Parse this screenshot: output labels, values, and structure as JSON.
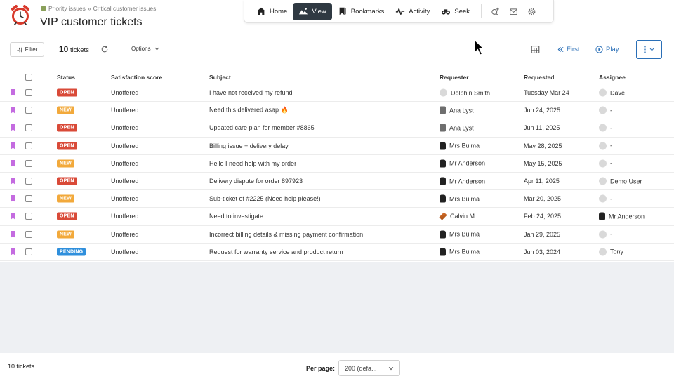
{
  "header": {
    "breadcrumb": {
      "parent": "Priority issues",
      "separator": "»",
      "current": "Critical customer issues"
    },
    "title": "VIP customer tickets"
  },
  "nav": {
    "items": [
      {
        "label": "Home",
        "icon": "home-icon",
        "active": false
      },
      {
        "label": "View",
        "icon": "view-icon",
        "active": true
      },
      {
        "label": "Bookmarks",
        "icon": "bookmarks-icon",
        "active": false
      },
      {
        "label": "Activity",
        "icon": "activity-icon",
        "active": false
      },
      {
        "label": "Seek",
        "icon": "binoculars-icon",
        "active": false
      }
    ],
    "icons": [
      "search-add-icon",
      "inbox-icon",
      "gear-icon"
    ]
  },
  "toolbar": {
    "filter_label": "Filter",
    "count_number": "10",
    "count_label": "tickets",
    "options_label": "Options",
    "first_label": "First",
    "play_label": "Play"
  },
  "table": {
    "columns": [
      "Status",
      "Satisfaction score",
      "Subject",
      "Requester",
      "Requested",
      "Assignee"
    ],
    "rows": [
      {
        "status": "OPEN",
        "satisfaction": "Unoffered",
        "subject": "I have not received my refund",
        "requester": "Dolphin Smith",
        "req_avatar": "gray",
        "requested": "Tuesday Mar 24",
        "assignee": "Dave",
        "asg_avatar": "gray"
      },
      {
        "status": "NEW",
        "satisfaction": "Unoffered",
        "subject": "Need this delivered asap 🔥",
        "requester": "Ana Lyst",
        "req_avatar": "lamp",
        "requested": "Jun 24, 2025",
        "assignee": "-",
        "asg_avatar": "gray"
      },
      {
        "status": "OPEN",
        "satisfaction": "Unoffered",
        "subject": "Updated care plan for member #8865",
        "requester": "Ana Lyst",
        "req_avatar": "lamp",
        "requested": "Jun 11, 2025",
        "assignee": "-",
        "asg_avatar": "gray"
      },
      {
        "status": "OPEN",
        "satisfaction": "Unoffered",
        "subject": "Billing issue + delivery delay",
        "requester": "Mrs Bulma",
        "req_avatar": "ninja",
        "requested": "May 28, 2025",
        "assignee": "-",
        "asg_avatar": "gray"
      },
      {
        "status": "NEW",
        "satisfaction": "Unoffered",
        "subject": "Hello I need help with my order",
        "requester": "Mr Anderson",
        "req_avatar": "ninja",
        "requested": "May 15, 2025",
        "assignee": "-",
        "asg_avatar": "gray"
      },
      {
        "status": "OPEN",
        "satisfaction": "Unoffered",
        "subject": "Delivery dispute for order 897923",
        "requester": "Mr Anderson",
        "req_avatar": "ninja",
        "requested": "Apr 11, 2025",
        "assignee": "Demo User",
        "asg_avatar": "gray"
      },
      {
        "status": "NEW",
        "satisfaction": "Unoffered",
        "subject": "Sub-ticket of #2225 (Need help please!)",
        "requester": "Mrs Bulma",
        "req_avatar": "ninja",
        "requested": "Mar 20, 2025",
        "assignee": "-",
        "asg_avatar": "gray"
      },
      {
        "status": "OPEN",
        "satisfaction": "Unoffered",
        "subject": "Need to investigate",
        "requester": "Calvin M.",
        "req_avatar": "pen",
        "requested": "Feb 24, 2025",
        "assignee": "Mr Anderson",
        "asg_avatar": "ninja"
      },
      {
        "status": "NEW",
        "satisfaction": "Unoffered",
        "subject": "Incorrect billing details & missing payment confirmation",
        "requester": "Mrs Bulma",
        "req_avatar": "ninja",
        "requested": "Jan 29, 2025",
        "assignee": "-",
        "asg_avatar": "gray"
      },
      {
        "status": "PENDING",
        "satisfaction": "Unoffered",
        "subject": "Request for warranty service and product return",
        "requester": "Mrs Bulma",
        "req_avatar": "ninja",
        "requested": "Jun 03, 2024",
        "assignee": "Tony",
        "asg_avatar": "gray"
      }
    ]
  },
  "status_colors": {
    "OPEN": "#d94a38",
    "NEW": "#f2a93b",
    "PENDING": "#2f8fdc"
  },
  "bookmark_color": "#c46be0",
  "footer": {
    "count": "10 tickets",
    "per_page_label": "Per page:",
    "per_page_value": "200 (defa..."
  }
}
